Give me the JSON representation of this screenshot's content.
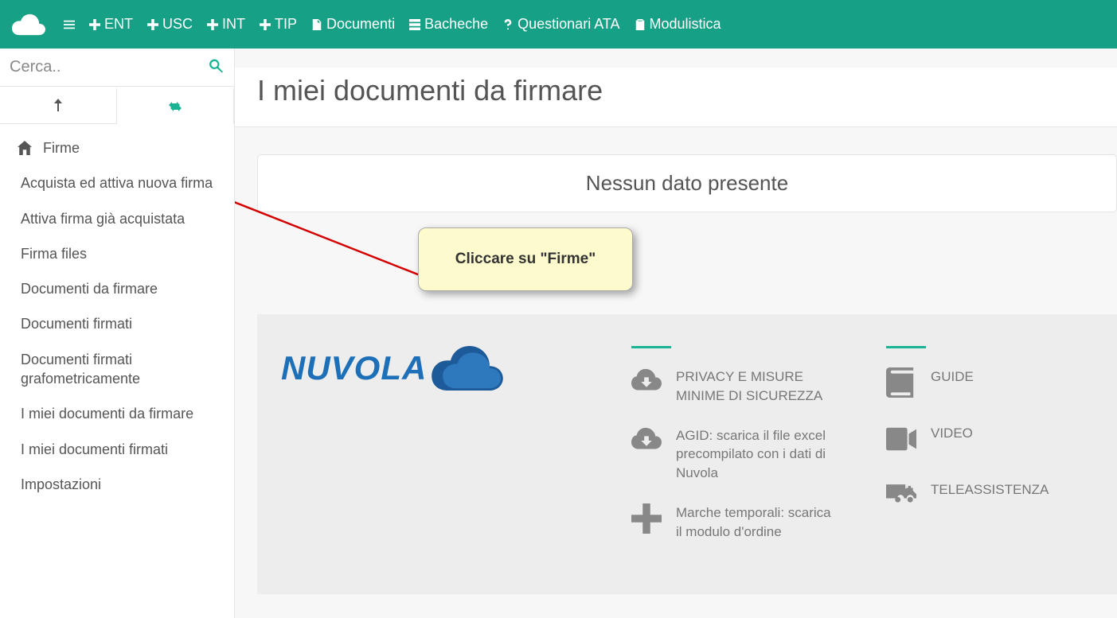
{
  "topbar": {
    "nav": [
      {
        "name": "ent",
        "label": "ENT",
        "icon": "plus"
      },
      {
        "name": "usc",
        "label": "USC",
        "icon": "plus"
      },
      {
        "name": "int",
        "label": "INT",
        "icon": "plus"
      },
      {
        "name": "tip",
        "label": "TIP",
        "icon": "plus"
      },
      {
        "name": "documenti",
        "label": "Documenti",
        "icon": "file"
      },
      {
        "name": "bacheche",
        "label": "Bacheche",
        "icon": "list"
      },
      {
        "name": "questionari",
        "label": "Questionari ATA",
        "icon": "question"
      },
      {
        "name": "modulistica",
        "label": "Modulistica",
        "icon": "clipboard"
      }
    ]
  },
  "sidebar": {
    "search_placeholder": "Cerca..",
    "menu_header": "Firme",
    "items": [
      "Acquista ed attiva nuova firma",
      "Attiva firma già acquistata",
      "Firma files",
      "Documenti da firmare",
      "Documenti firmati",
      "Documenti firmati grafometricamente",
      "I miei documenti da firmare",
      "I miei documenti firmati",
      "Impostazioni"
    ]
  },
  "main": {
    "title": "I miei documenti da firmare",
    "empty_message": "Nessun dato presente"
  },
  "annotation": {
    "callout_text": "Cliccare su \"Firme\""
  },
  "footer": {
    "brand": "NUVOLA",
    "col2": [
      "PRIVACY E MISURE MINIME DI SICUREZZA",
      "AGID: scarica il file excel precompilato con i dati di Nuvola",
      "Marche temporali: scarica il modulo d'ordine"
    ],
    "col3": [
      "GUIDE",
      "VIDEO",
      "TELEASSISTENZA"
    ]
  }
}
